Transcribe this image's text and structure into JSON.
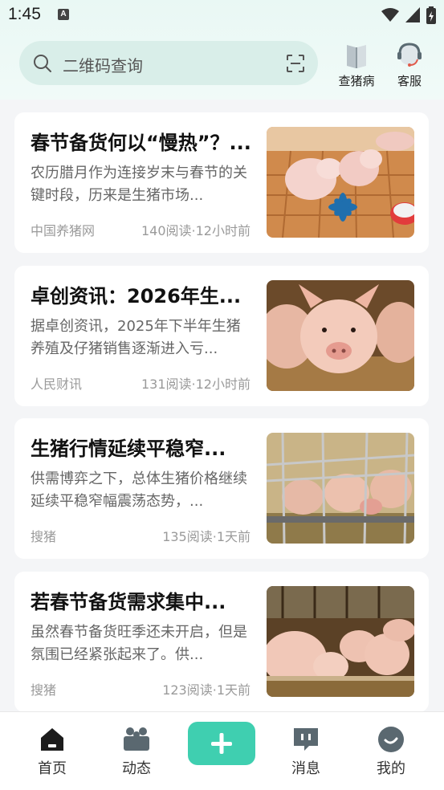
{
  "status": {
    "time": "1:45"
  },
  "search": {
    "placeholder": "二维码查询"
  },
  "top_actions": [
    {
      "label": "查猪病",
      "icon": "book-icon"
    },
    {
      "label": "客服",
      "icon": "customer-service-icon"
    }
  ],
  "articles": [
    {
      "title": "春节备货何以“慢热”？...",
      "summary": "农历腊月作为连接岁末与春节的关键时段，历来是生猪市场...",
      "source": "中国养猪网",
      "meta": "140阅读·12小时前",
      "image": "piglets-with-toy"
    },
    {
      "title": "卓创资讯：2026年生...",
      "summary": "据卓创资讯，2025年下半年生猪养殖及仔猪销售逐渐进入亏...",
      "source": "人民财讯",
      "meta": "131阅读·12小时前",
      "image": "piglet-closeup"
    },
    {
      "title": "生猪行情延续平稳窄...",
      "summary": "供需博弈之下，总体生猪价格继续延续平稳窄幅震荡态势，...",
      "source": "搜猪",
      "meta": "135阅读·1天前",
      "image": "pigs-in-pens"
    },
    {
      "title": "若春节备货需求集中...",
      "summary": "虽然春节备货旺季还未开启，但是氛围已经紧张起来了。供...",
      "source": "搜猪",
      "meta": "123阅读·1天前",
      "image": "pigs-feeding"
    }
  ],
  "bottom_nav": [
    {
      "label": "首页",
      "icon": "home-icon",
      "active": true
    },
    {
      "label": "动态",
      "icon": "community-icon"
    },
    {
      "label": "",
      "icon": "plus-icon"
    },
    {
      "label": "消息",
      "icon": "message-icon"
    },
    {
      "label": "我的",
      "icon": "profile-icon"
    }
  ],
  "colors": {
    "accent": "#3fcfb0",
    "search_bg": "#d9eee9"
  }
}
